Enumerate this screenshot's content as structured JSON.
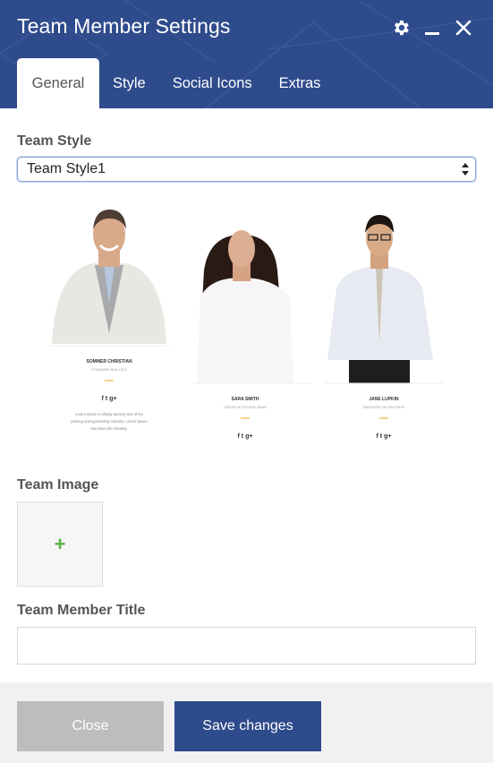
{
  "dialog": {
    "title": "Team Member Settings",
    "icons": [
      "gear-icon",
      "minimize-icon",
      "close-icon"
    ]
  },
  "tabs": [
    {
      "label": "General",
      "active": true
    },
    {
      "label": "Style",
      "active": false
    },
    {
      "label": "Social Icons",
      "active": false
    },
    {
      "label": "Extras",
      "active": false
    }
  ],
  "team_style": {
    "label": "Team Style",
    "selected": "Team Style1"
  },
  "preview": {
    "members": [
      {
        "name": "SOMMER CHRISTIAN",
        "role": "FOUNDER AND CEO",
        "bio": [
          "Lorem Ipsum is simply dummy text of the",
          "printing and typesetting industry. Lorem Ipsum",
          "has been the industry."
        ]
      },
      {
        "name": "SARA SMITH",
        "role": "CREATIVE STUDIO HEAD"
      },
      {
        "name": "JANE LUPKIN",
        "role": "MAGENTO DEVELOPER"
      }
    ],
    "social_glyphs": [
      "f",
      "t",
      "g+"
    ]
  },
  "team_image": {
    "label": "Team Image",
    "add_symbol": "+"
  },
  "member_title": {
    "label": "Team Member Title",
    "value": "",
    "placeholder": ""
  },
  "footer": {
    "cancel_label": "Close",
    "save_label": "Save changes"
  },
  "colors": {
    "header": "#2e4b8c",
    "save_button": "#2e4b8c",
    "cancel_button": "#bdbdbd",
    "plus": "#58b044",
    "accent_line": "#f0b840"
  }
}
